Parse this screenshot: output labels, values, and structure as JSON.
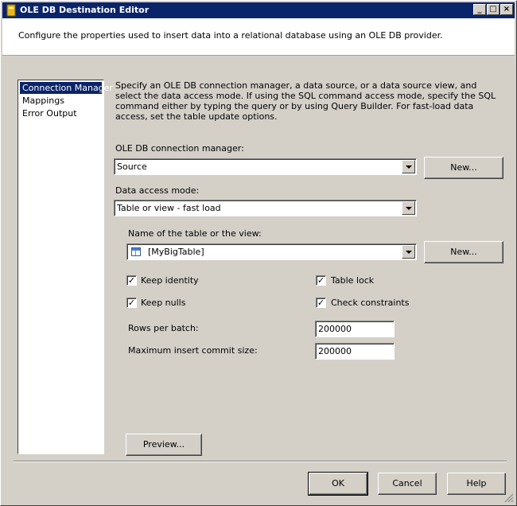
{
  "window": {
    "title": "OLE DB Destination Editor",
    "minimize": "_",
    "maximize": "□",
    "close": "×"
  },
  "header": {
    "text": "Configure the properties used to insert data into a relational database using an OLE DB provider."
  },
  "nav": {
    "items": [
      {
        "label": "Connection Manager",
        "selected": true
      },
      {
        "label": "Mappings",
        "selected": false
      },
      {
        "label": "Error Output",
        "selected": false
      }
    ]
  },
  "main": {
    "description": "Specify an OLE DB connection manager, a data source, or a data source view, and select the data access mode. If using the SQL command access mode, specify the SQL command either by typing the query or by using Query Builder. For fast-load data access, set the table update options.",
    "connection_label": "OLE DB connection manager:",
    "connection_value": "Source",
    "connection_new": "New...",
    "access_label": "Data access mode:",
    "access_value": "Table or view - fast load",
    "table_label": "Name of the table or the view:",
    "table_value": "[MyBigTable]",
    "table_new": "New...",
    "options": {
      "keep_identity": {
        "label": "Keep identity",
        "checked": true
      },
      "table_lock": {
        "label": "Table lock",
        "checked": true
      },
      "keep_nulls": {
        "label": "Keep nulls",
        "checked": true
      },
      "check_constraints": {
        "label": "Check constraints",
        "checked": true
      }
    },
    "rows_per_batch_label": "Rows per batch:",
    "rows_per_batch_value": "200000",
    "max_commit_label": "Maximum insert commit size:",
    "max_commit_value": "200000",
    "preview": "Preview..."
  },
  "footer": {
    "ok": "OK",
    "cancel": "Cancel",
    "help": "Help"
  },
  "icons": {
    "title": "package-icon",
    "table": "table-icon",
    "check": "checkmark-icon",
    "dropdown": "chevron-down-icon",
    "grip": "resize-grip-icon"
  }
}
